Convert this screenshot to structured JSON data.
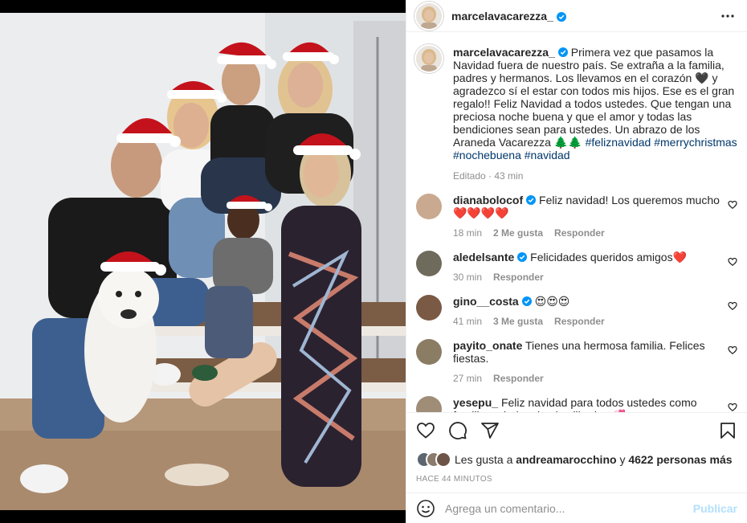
{
  "photo": {
    "alt": "Family photo with Santa hats and a white dog"
  },
  "header": {
    "username": "marcelavacarezza_",
    "verified": true
  },
  "caption": {
    "username": "marcelavacarezza_",
    "text": "Primera vez que pasamos la Navidad fuera de nuestro país. Se extraña a la familia, padres y hermanos. Los llevamos en el corazón 🖤 y agradezco sí el estar con todos mis hijos. Ese es el gran regalo!! Feliz Navidad a todos ustedes. Que tengan una preciosa noche buena y que el amor y todas las bendiciones sean para ustedes. Un abrazo de los Araneda Vacarezza 🌲🌲",
    "hashtags": [
      "#feliznavidad",
      "#merrychristmas",
      "#nochebuena",
      "#navidad"
    ],
    "edited": "Editado",
    "time": "43 min"
  },
  "comments": [
    {
      "username": "dianabolocof",
      "verified": true,
      "text": "Feliz navidad! Los queremos mucho ❤️❤️❤️❤️",
      "time": "18 min",
      "likes": "2 Me gusta",
      "reply": "Responder",
      "avatar_color": "#c9a98f"
    },
    {
      "username": "aledelsante",
      "verified": true,
      "text": "Felicidades queridos amigos❤️",
      "time": "30 min",
      "likes": "",
      "reply": "Responder",
      "avatar_color": "#6e6a5c"
    },
    {
      "username": "gino__costa",
      "verified": true,
      "text": "😍😍😍",
      "time": "41 min",
      "likes": "3 Me gusta",
      "reply": "Responder",
      "avatar_color": "#7a5a45"
    },
    {
      "username": "payito_onate",
      "verified": false,
      "text": "Tienes una hermosa familia. Felices fiestas.",
      "time": "27 min",
      "likes": "",
      "reply": "Responder",
      "avatar_color": "#8b7d64"
    },
    {
      "username": "yesepu_",
      "verified": false,
      "text": "Feliz navidad para todos ustedes como familia..saludos desde villarrica 💞",
      "time": "",
      "likes": "",
      "reply": "",
      "avatar_color": "#a08d78"
    }
  ],
  "likes": {
    "prefix": "Les gusta a",
    "user": "andreamarocchino",
    "conj": "y",
    "others": "4622 personas más"
  },
  "timeago": "HACE 44 MINUTOS",
  "add_comment": {
    "placeholder": "Agrega un comentario...",
    "publish": "Publicar"
  },
  "colors": {
    "verified": "#0095f6",
    "hashtag": "#00376b",
    "muted": "#8e8e8e",
    "publish_disabled": "#b2dffc"
  }
}
